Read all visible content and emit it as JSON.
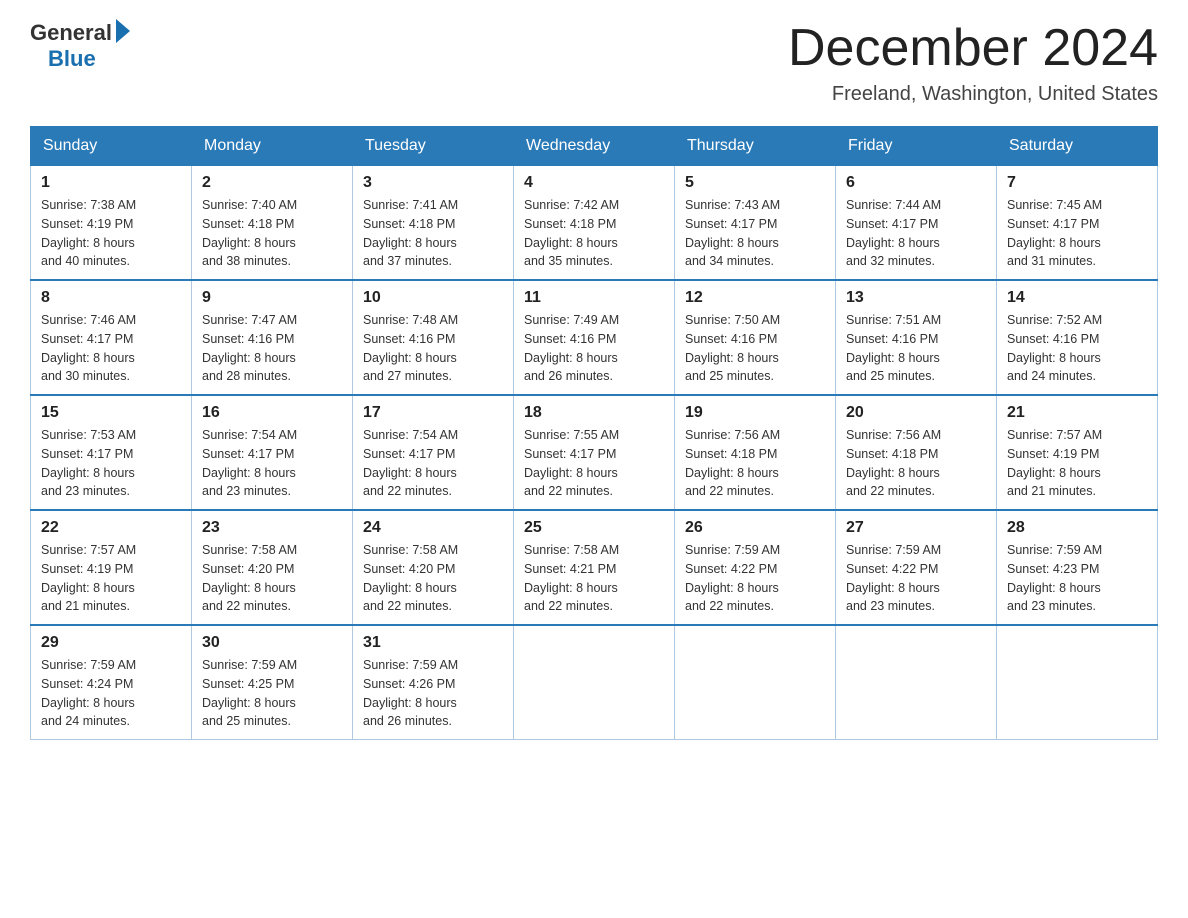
{
  "logo": {
    "general": "General",
    "blue": "Blue"
  },
  "title": "December 2024",
  "subtitle": "Freeland, Washington, United States",
  "days_of_week": [
    "Sunday",
    "Monday",
    "Tuesday",
    "Wednesday",
    "Thursday",
    "Friday",
    "Saturday"
  ],
  "weeks": [
    [
      {
        "day": "1",
        "sunrise": "7:38 AM",
        "sunset": "4:19 PM",
        "daylight": "8 hours and 40 minutes."
      },
      {
        "day": "2",
        "sunrise": "7:40 AM",
        "sunset": "4:18 PM",
        "daylight": "8 hours and 38 minutes."
      },
      {
        "day": "3",
        "sunrise": "7:41 AM",
        "sunset": "4:18 PM",
        "daylight": "8 hours and 37 minutes."
      },
      {
        "day": "4",
        "sunrise": "7:42 AM",
        "sunset": "4:18 PM",
        "daylight": "8 hours and 35 minutes."
      },
      {
        "day": "5",
        "sunrise": "7:43 AM",
        "sunset": "4:17 PM",
        "daylight": "8 hours and 34 minutes."
      },
      {
        "day": "6",
        "sunrise": "7:44 AM",
        "sunset": "4:17 PM",
        "daylight": "8 hours and 32 minutes."
      },
      {
        "day": "7",
        "sunrise": "7:45 AM",
        "sunset": "4:17 PM",
        "daylight": "8 hours and 31 minutes."
      }
    ],
    [
      {
        "day": "8",
        "sunrise": "7:46 AM",
        "sunset": "4:17 PM",
        "daylight": "8 hours and 30 minutes."
      },
      {
        "day": "9",
        "sunrise": "7:47 AM",
        "sunset": "4:16 PM",
        "daylight": "8 hours and 28 minutes."
      },
      {
        "day": "10",
        "sunrise": "7:48 AM",
        "sunset": "4:16 PM",
        "daylight": "8 hours and 27 minutes."
      },
      {
        "day": "11",
        "sunrise": "7:49 AM",
        "sunset": "4:16 PM",
        "daylight": "8 hours and 26 minutes."
      },
      {
        "day": "12",
        "sunrise": "7:50 AM",
        "sunset": "4:16 PM",
        "daylight": "8 hours and 25 minutes."
      },
      {
        "day": "13",
        "sunrise": "7:51 AM",
        "sunset": "4:16 PM",
        "daylight": "8 hours and 25 minutes."
      },
      {
        "day": "14",
        "sunrise": "7:52 AM",
        "sunset": "4:16 PM",
        "daylight": "8 hours and 24 minutes."
      }
    ],
    [
      {
        "day": "15",
        "sunrise": "7:53 AM",
        "sunset": "4:17 PM",
        "daylight": "8 hours and 23 minutes."
      },
      {
        "day": "16",
        "sunrise": "7:54 AM",
        "sunset": "4:17 PM",
        "daylight": "8 hours and 23 minutes."
      },
      {
        "day": "17",
        "sunrise": "7:54 AM",
        "sunset": "4:17 PM",
        "daylight": "8 hours and 22 minutes."
      },
      {
        "day": "18",
        "sunrise": "7:55 AM",
        "sunset": "4:17 PM",
        "daylight": "8 hours and 22 minutes."
      },
      {
        "day": "19",
        "sunrise": "7:56 AM",
        "sunset": "4:18 PM",
        "daylight": "8 hours and 22 minutes."
      },
      {
        "day": "20",
        "sunrise": "7:56 AM",
        "sunset": "4:18 PM",
        "daylight": "8 hours and 22 minutes."
      },
      {
        "day": "21",
        "sunrise": "7:57 AM",
        "sunset": "4:19 PM",
        "daylight": "8 hours and 21 minutes."
      }
    ],
    [
      {
        "day": "22",
        "sunrise": "7:57 AM",
        "sunset": "4:19 PM",
        "daylight": "8 hours and 21 minutes."
      },
      {
        "day": "23",
        "sunrise": "7:58 AM",
        "sunset": "4:20 PM",
        "daylight": "8 hours and 22 minutes."
      },
      {
        "day": "24",
        "sunrise": "7:58 AM",
        "sunset": "4:20 PM",
        "daylight": "8 hours and 22 minutes."
      },
      {
        "day": "25",
        "sunrise": "7:58 AM",
        "sunset": "4:21 PM",
        "daylight": "8 hours and 22 minutes."
      },
      {
        "day": "26",
        "sunrise": "7:59 AM",
        "sunset": "4:22 PM",
        "daylight": "8 hours and 22 minutes."
      },
      {
        "day": "27",
        "sunrise": "7:59 AM",
        "sunset": "4:22 PM",
        "daylight": "8 hours and 23 minutes."
      },
      {
        "day": "28",
        "sunrise": "7:59 AM",
        "sunset": "4:23 PM",
        "daylight": "8 hours and 23 minutes."
      }
    ],
    [
      {
        "day": "29",
        "sunrise": "7:59 AM",
        "sunset": "4:24 PM",
        "daylight": "8 hours and 24 minutes."
      },
      {
        "day": "30",
        "sunrise": "7:59 AM",
        "sunset": "4:25 PM",
        "daylight": "8 hours and 25 minutes."
      },
      {
        "day": "31",
        "sunrise": "7:59 AM",
        "sunset": "4:26 PM",
        "daylight": "8 hours and 26 minutes."
      },
      null,
      null,
      null,
      null
    ]
  ],
  "labels": {
    "sunrise": "Sunrise:",
    "sunset": "Sunset:",
    "daylight": "Daylight:"
  }
}
